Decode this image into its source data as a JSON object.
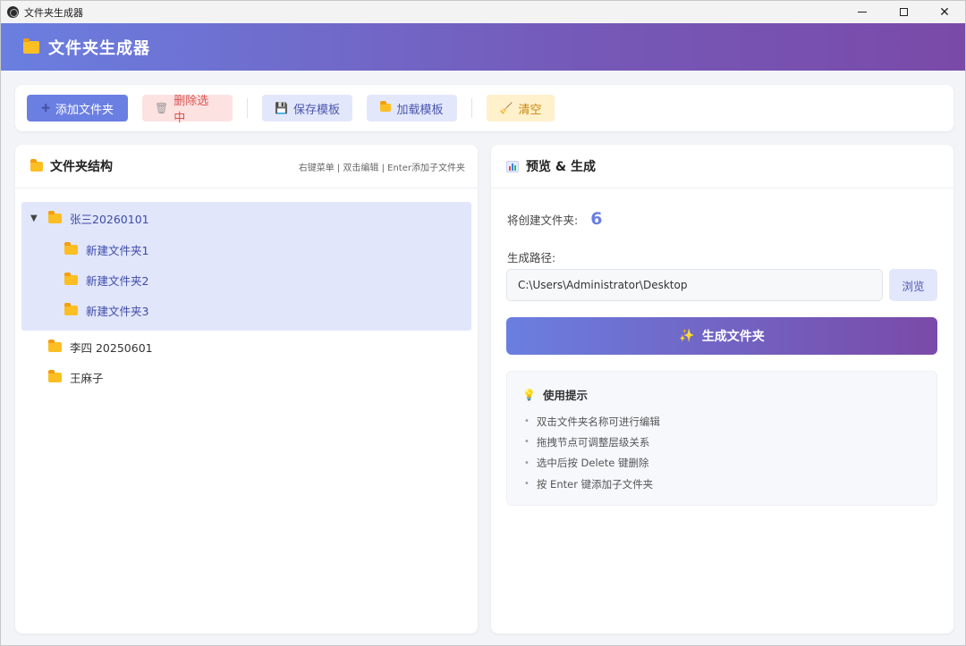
{
  "window": {
    "title": "文件夹生成器"
  },
  "header": {
    "title": "文件夹生成器"
  },
  "toolbar": {
    "add_label": "添加文件夹",
    "delete_label": "删除选中",
    "save_label": "保存模板",
    "load_label": "加载模板",
    "clear_label": "清空"
  },
  "tree_panel": {
    "title": "文件夹结构",
    "hint": "右键菜单 | 双击编辑 | Enter添加子文件夹",
    "nodes": [
      {
        "label": "张三20260101",
        "expanded": true,
        "selected": true,
        "children": [
          {
            "label": "新建文件夹1"
          },
          {
            "label": "新建文件夹2"
          },
          {
            "label": "新建文件夹3"
          }
        ]
      },
      {
        "label": "李四 20250601"
      },
      {
        "label": "王麻子"
      }
    ]
  },
  "preview_panel": {
    "title": "预览 & 生成",
    "count_label": "将创建文件夹:",
    "count_value": "6",
    "path_label": "生成路径:",
    "path_value": "C:\\Users\\Administrator\\Desktop",
    "browse_label": "浏览",
    "generate_label": "生成文件夹",
    "tips": {
      "title": "使用提示",
      "items": [
        "双击文件夹名称可进行编辑",
        "拖拽节点可调整层级关系",
        "选中后按 Delete 键删除",
        "按 Enter 键添加子文件夹"
      ]
    }
  },
  "colors": {
    "accent": "#6b7fe3",
    "accent_dark": "#7a4aa8",
    "danger_bg": "#fde2e2",
    "warn_bg": "#fff1cc",
    "folder": "#fbbf24"
  },
  "icons": {
    "app": "app-icon",
    "folder": "folder-icon",
    "add": "plus-icon",
    "delete": "trash-icon",
    "save": "floppy-icon",
    "clear": "broom-icon",
    "preview": "chart-icon",
    "generate": "sparkle-icon",
    "tips": "lightbulb-icon"
  }
}
